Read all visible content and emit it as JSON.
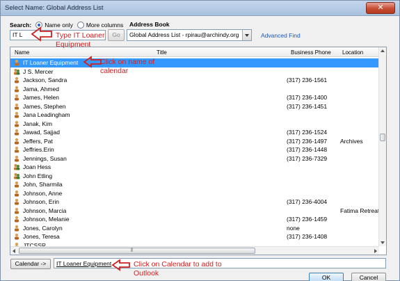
{
  "window": {
    "title": "Select Name: Global Address List"
  },
  "search": {
    "label": "Search:",
    "value": "IT L",
    "go_label": "Go",
    "option_name_only": "Name only",
    "option_more_columns": "More columns",
    "selected_option": "Name only"
  },
  "address_book": {
    "label": "Address Book",
    "selected": "Global Address List - rpirau@archindy.org",
    "advanced_find": "Advanced Find"
  },
  "columns": {
    "name": "Name",
    "title": "Title",
    "phone": "Business Phone",
    "location": "Location"
  },
  "rows": [
    {
      "name": "IT Loaner Equipment",
      "phone": "",
      "location": "",
      "icon": "resource-icon",
      "selected": true
    },
    {
      "name": "J S. Mercer",
      "phone": "",
      "location": "",
      "icon": "group-icon"
    },
    {
      "name": "Jackson, Sandra",
      "phone": "(317) 236-1561",
      "location": "",
      "icon": "person-icon"
    },
    {
      "name": "Jama, Ahmed",
      "phone": "",
      "location": "",
      "icon": "person-icon"
    },
    {
      "name": "James, Helen",
      "phone": "(317) 236-1400",
      "location": "",
      "icon": "person-icon"
    },
    {
      "name": "James, Stephen",
      "phone": "(317) 236-1451",
      "location": "",
      "icon": "person-icon"
    },
    {
      "name": "Jana Leadingham",
      "phone": "",
      "location": "",
      "icon": "person-icon"
    },
    {
      "name": "Janak, Kim",
      "phone": "",
      "location": "",
      "icon": "person-icon"
    },
    {
      "name": "Jawad, Sajjad",
      "phone": "(317) 236-1524",
      "location": "",
      "icon": "person-icon"
    },
    {
      "name": "Jeffers, Pat",
      "phone": "(317) 236-1497",
      "location": "Archives",
      "icon": "person-icon"
    },
    {
      "name": "Jeffries.Erin",
      "phone": "(317) 236-1448",
      "location": "",
      "icon": "person-icon"
    },
    {
      "name": "Jennings, Susan",
      "phone": "(317) 236-7329",
      "location": "",
      "icon": "person-icon"
    },
    {
      "name": "Joan Hess",
      "phone": "",
      "location": "",
      "icon": "group-icon"
    },
    {
      "name": "John Etling",
      "phone": "",
      "location": "",
      "icon": "group-icon"
    },
    {
      "name": "John, Sharmila",
      "phone": "",
      "location": "",
      "icon": "person-icon"
    },
    {
      "name": "Johnson, Anne",
      "phone": "",
      "location": "",
      "icon": "person-icon"
    },
    {
      "name": "Johnson, Erin",
      "phone": "(317) 236-4004",
      "location": "",
      "icon": "person-icon"
    },
    {
      "name": "Johnson, Marcia",
      "phone": "",
      "location": "Fatima Retreat",
      "icon": "person-icon"
    },
    {
      "name": "Johnson, Melanie",
      "phone": "(317) 236-1459",
      "location": "",
      "icon": "person-icon"
    },
    {
      "name": "Jones, Carolyn",
      "phone": "none",
      "location": "",
      "icon": "person-icon"
    },
    {
      "name": "Jones, Teresa",
      "phone": "(317) 236-1408",
      "location": "",
      "icon": "person-icon"
    },
    {
      "name": "JTCSSR",
      "phone": "",
      "location": "",
      "icon": "person-icon"
    }
  ],
  "calendar": {
    "button_label": "Calendar ->",
    "value": "IT Loaner Equipment"
  },
  "buttons": {
    "ok": "OK",
    "cancel": "Cancel"
  },
  "annotations": {
    "type_hint": "Type IT Loaner Equipment",
    "click_name_hint": "Click on name of calendar",
    "click_calendar_hint": "Click on Calendar to add to Outlook",
    "color": "#d02020"
  }
}
